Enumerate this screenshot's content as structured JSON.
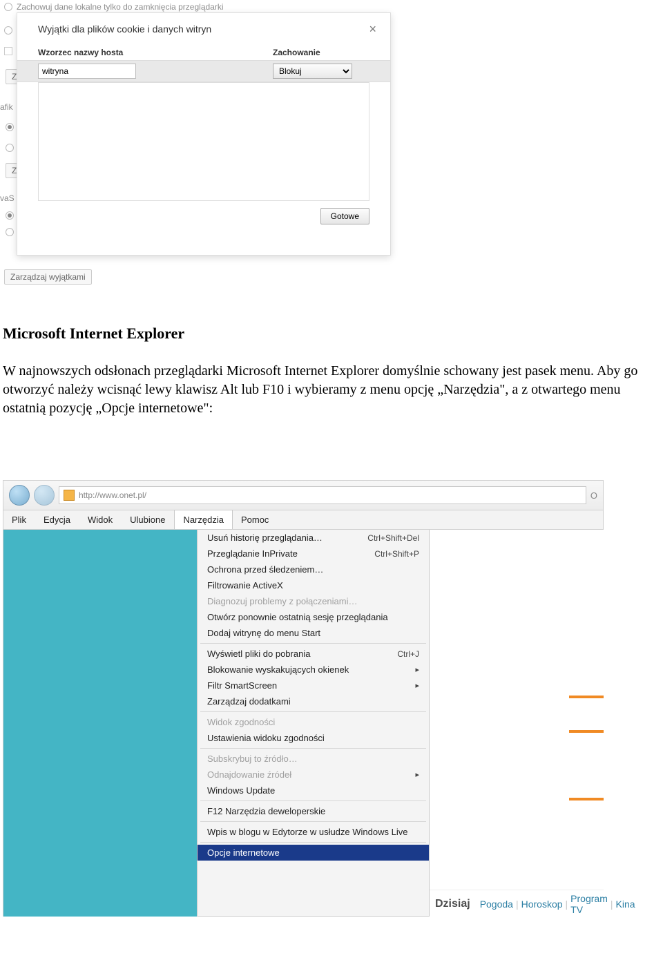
{
  "chrome_options": {
    "keep_until_close": "Zachowuj dane lokalne tylko do zamknięcia przeglądarki",
    "manage_exceptions_btn": "Zarządzaj wyjątkami",
    "left_cut_labels": {
      "afik": "afik",
      "vas": "vaS",
      "z1": "Z",
      "z2": "Z"
    }
  },
  "cookie_dialog": {
    "title": "Wyjątki dla plików cookie i danych witryn",
    "col_host": "Wzorzec nazwy hosta",
    "col_behavior": "Zachowanie",
    "host_value": "witryna",
    "behavior_value": "Blokuj",
    "done_btn": "Gotowe"
  },
  "article": {
    "heading": "Microsoft Internet Explorer",
    "para": "W najnowszych odsłonach przeglądarki Microsoft Internet Explorer domyślnie schowany jest pasek menu. Aby go otworzyć należy wcisnąć lewy klawisz Alt lub F10 i wybieramy z menu opcję „Narzędzia\", a z otwartego menu ostatnią pozycję „Opcje internetowe\":"
  },
  "ie_screenshot": {
    "url_text": "http://www.onet.pl/",
    "menubar": [
      "Plik",
      "Edycja",
      "Widok",
      "Ulubione",
      "Narzędzia",
      "Pomoc"
    ],
    "menu": [
      {
        "label": "Usuń historię przeglądania…",
        "shortcut": "Ctrl+Shift+Del",
        "type": "item"
      },
      {
        "label": "Przeglądanie InPrivate",
        "shortcut": "Ctrl+Shift+P",
        "type": "item"
      },
      {
        "label": "Ochrona przed śledzeniem…",
        "type": "item"
      },
      {
        "label": "Filtrowanie ActiveX",
        "type": "item"
      },
      {
        "label": "Diagnozuj problemy z połączeniami…",
        "type": "disabled"
      },
      {
        "label": "Otwórz ponownie ostatnią sesję przeglądania",
        "type": "item"
      },
      {
        "label": "Dodaj witrynę do menu Start",
        "type": "item"
      },
      {
        "type": "sep"
      },
      {
        "label": "Wyświetl pliki do pobrania",
        "shortcut": "Ctrl+J",
        "type": "item"
      },
      {
        "label": "Blokowanie wyskakujących okienek",
        "type": "submenu"
      },
      {
        "label": "Filtr SmartScreen",
        "type": "submenu"
      },
      {
        "label": "Zarządzaj dodatkami",
        "type": "item"
      },
      {
        "type": "sep"
      },
      {
        "label": "Widok zgodności",
        "type": "disabled"
      },
      {
        "label": "Ustawienia widoku zgodności",
        "type": "item"
      },
      {
        "type": "sep"
      },
      {
        "label": "Subskrybuj to źródło…",
        "type": "disabled"
      },
      {
        "label": "Odnajdowanie źródeł",
        "type": "disabled-submenu"
      },
      {
        "label": "Windows Update",
        "type": "item"
      },
      {
        "type": "sep"
      },
      {
        "label": "F12 Narzędzia deweloperskie",
        "type": "item"
      },
      {
        "type": "sep"
      },
      {
        "label": "Wpis w blogu w Edytorze w usłudze Windows Live",
        "type": "item"
      },
      {
        "type": "sep"
      },
      {
        "label": "Opcje internetowe",
        "type": "selected"
      }
    ],
    "bottom_nav": {
      "today": "Dzisiaj",
      "links": [
        "Pogoda",
        "Horoskop",
        "Program TV",
        "Kina"
      ]
    },
    "right_corner_label": "O"
  }
}
